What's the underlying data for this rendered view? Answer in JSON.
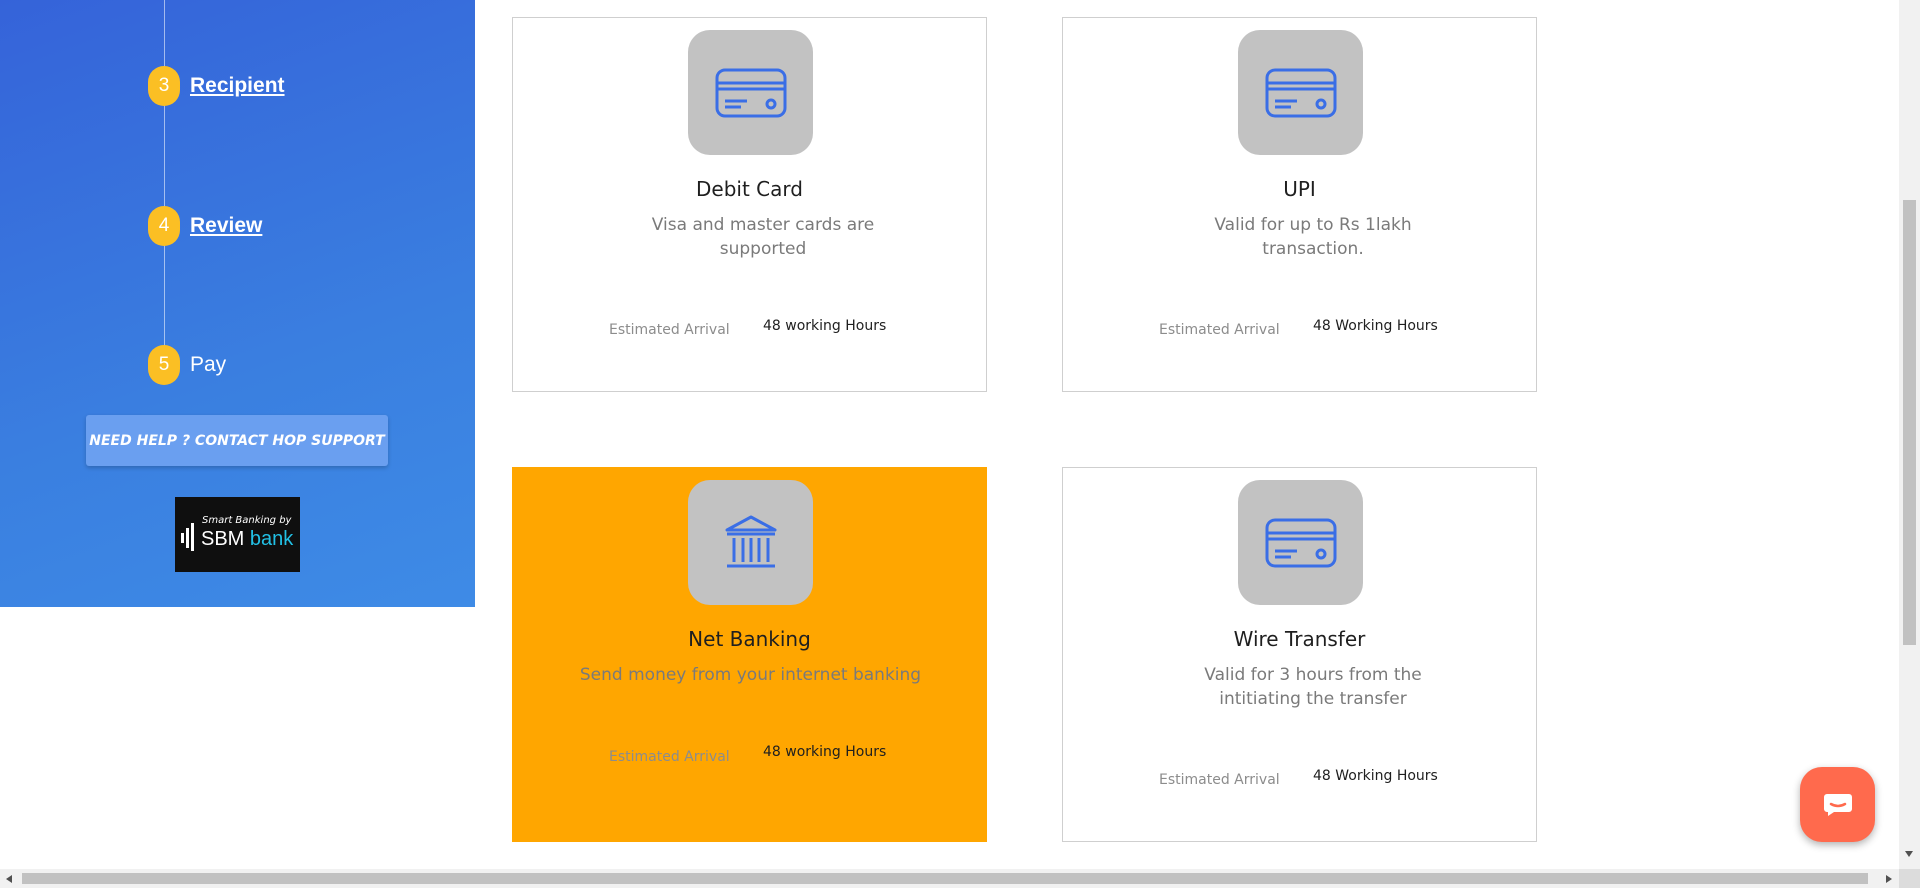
{
  "sidebar": {
    "steps": [
      {
        "number": "3",
        "label": "Recipient"
      },
      {
        "number": "4",
        "label": "Review"
      },
      {
        "number": "5",
        "label": "Pay"
      }
    ],
    "help_button": "NEED HELP ? CONTACT HOP SUPPORT",
    "logo": {
      "tagline": "Smart Banking by",
      "name": "SBM",
      "sub": "bank"
    }
  },
  "payment_methods": [
    {
      "title": "Debit Card",
      "description": "Visa and master cards are supported",
      "arrival_label": "Estimated Arrival",
      "arrival_value": "48 working Hours",
      "icon": "credit-card-icon",
      "selected": false
    },
    {
      "title": "UPI",
      "description": "Valid for up to Rs 1lakh transaction.",
      "arrival_label": "Estimated Arrival",
      "arrival_value": "48 Working Hours",
      "icon": "credit-card-icon",
      "selected": false
    },
    {
      "title": "Net Banking",
      "description": "Send money from your internet banking",
      "arrival_label": "Estimated Arrival",
      "arrival_value": "48 working Hours",
      "icon": "bank-icon",
      "selected": true
    },
    {
      "title": "Wire Transfer",
      "description": "Valid for 3 hours from the intitiating the transfer",
      "arrival_label": "Estimated Arrival",
      "arrival_value": "48 Working Hours",
      "icon": "credit-card-icon",
      "selected": false
    }
  ],
  "colors": {
    "sidebar_gradient_start": "#3563d9",
    "sidebar_gradient_end": "#3e8be6",
    "step_badge": "#fbbf24",
    "selected_card": "#ffa600",
    "icon_tile": "#c2c2c2",
    "icon_stroke": "#3a6ee6",
    "chat_button": "#ff6a4d"
  },
  "chat": {
    "icon": "chat-bubble-icon"
  }
}
